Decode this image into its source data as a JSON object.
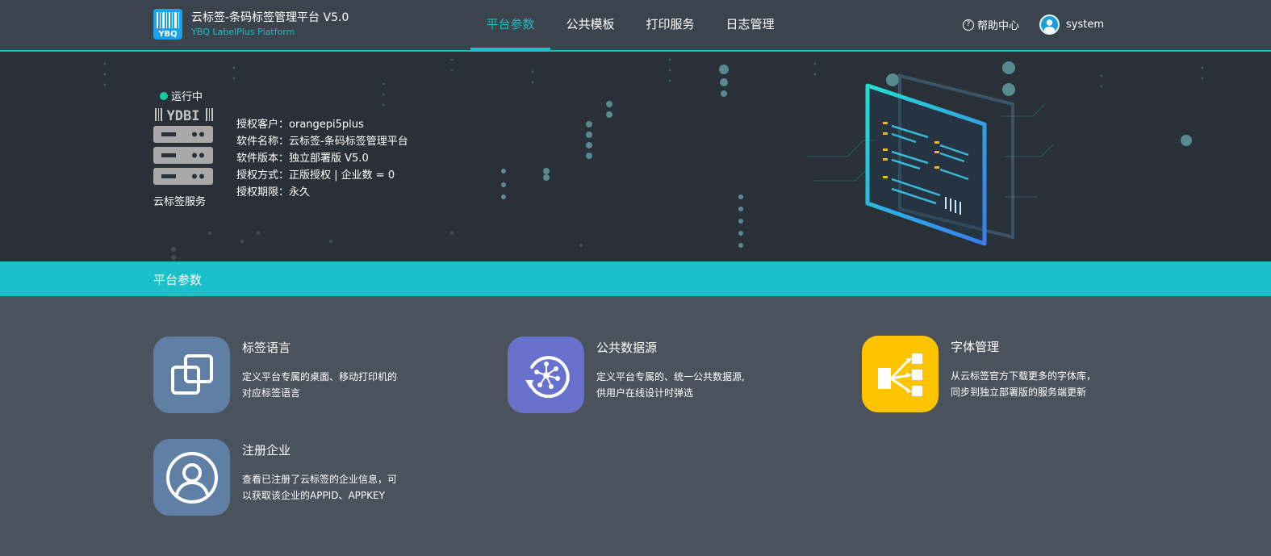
{
  "header": {
    "title": "云标签-条码标签管理平台 V5.0",
    "subtitle": "YBQ LabelPlus Platform",
    "logo_text": "YBQ",
    "nav": [
      {
        "label": "平台参数",
        "active": true
      },
      {
        "label": "公共模板",
        "active": false
      },
      {
        "label": "打印服务",
        "active": false
      },
      {
        "label": "日志管理",
        "active": false
      }
    ],
    "help_label": "帮助中心",
    "help_icon": "?",
    "username": "system"
  },
  "hero": {
    "status": "运行中",
    "server_logo_text": "YDBI",
    "server_label": "云标签服务",
    "info": [
      {
        "key": "授权客户：",
        "value": "orangepi5plus"
      },
      {
        "key": "软件名称：",
        "value": "云标签-条码标签管理平台"
      },
      {
        "key": "软件版本：",
        "value": "独立部署版 V5.0"
      },
      {
        "key": "授权方式：",
        "value": "正版授权 | 企业数 = 0"
      },
      {
        "key": "授权期限：",
        "value": "永久"
      }
    ]
  },
  "section": {
    "title": "平台参数"
  },
  "cards": [
    {
      "title": "标签语言",
      "desc": "定义平台专属的桌面、移动打印机的对应标签语言",
      "color": "#5f7fa5",
      "icon": "copy-squares-icon"
    },
    {
      "title": "公共数据源",
      "desc": "定义平台专属的、统一公共数据源,供用户在线设计时弹选",
      "color": "#6872cc",
      "icon": "data-source-icon"
    },
    {
      "title": "字体管理",
      "desc": "从云标签官方下载更多的字体库， 同步到独立部署版的服务端更新",
      "color": "#ffc400",
      "icon": "font-tree-icon"
    },
    {
      "title": "注册企业",
      "desc": "查看已注册了云标签的企业信息，可以获取该企业的APPID、APPKEY",
      "color": "#5f7fa5",
      "icon": "user-circle-icon"
    }
  ],
  "colors": {
    "accent": "#1bbfc7",
    "header_bg": "#3b434d",
    "body_bg": "#4a525c"
  }
}
